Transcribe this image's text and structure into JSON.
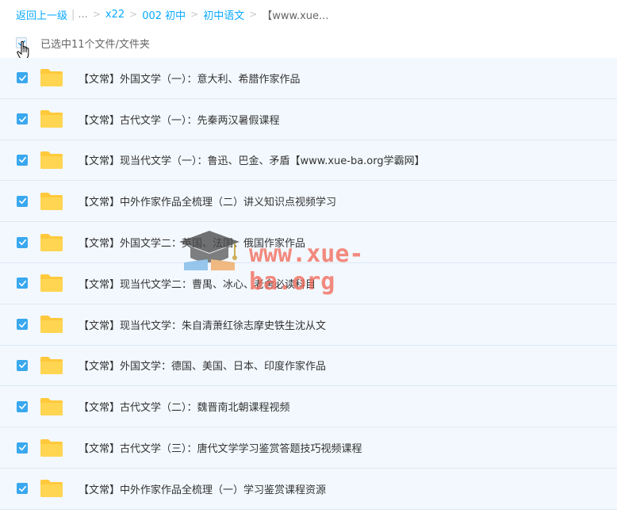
{
  "breadcrumb": {
    "back": "返回上一级",
    "ellipsis": "...",
    "sep": ">",
    "crumbs": [
      "x22",
      "002 初中",
      "初中语文"
    ],
    "current": "【www.xue..."
  },
  "selection": {
    "count_text": "已选中11个文件/文件夹"
  },
  "files": [
    {
      "name": "【文常】外国文学（一）：意大利、希腊作家作品"
    },
    {
      "name": "【文常】古代文学（一）：先秦两汉暑假课程"
    },
    {
      "name": "【文常】现当代文学（一）：鲁迅、巴金、矛盾【www.xue-ba.org学霸网】"
    },
    {
      "name": "【文常】中外作家作品全梳理（二）讲义知识点视频学习"
    },
    {
      "name": "【文常】外国文学二：英国、法国、俄国作家作品"
    },
    {
      "name": "【文常】现当代文学二：曹禺、冰心、老舍必读科目"
    },
    {
      "name": "【文常】现当代文学：朱自清萧红徐志摩史铁生沈从文"
    },
    {
      "name": "【文常】外国文学：德国、美国、日本、印度作家作品"
    },
    {
      "name": "【文常】古代文学（二）：魏晋南北朝课程视频"
    },
    {
      "name": "【文常】古代文学（三）：唐代文学学习鉴赏答题技巧视频课程"
    },
    {
      "name": "【文常】中外作家作品全梳理（一）学习鉴赏课程资源"
    }
  ],
  "watermark": {
    "text": "www.xue-ba.org"
  },
  "colors": {
    "accent": "#09aaff",
    "checkbox": "#3aa8ef",
    "row_bg": "#f3f8fe",
    "folder": "#ffc93b"
  }
}
